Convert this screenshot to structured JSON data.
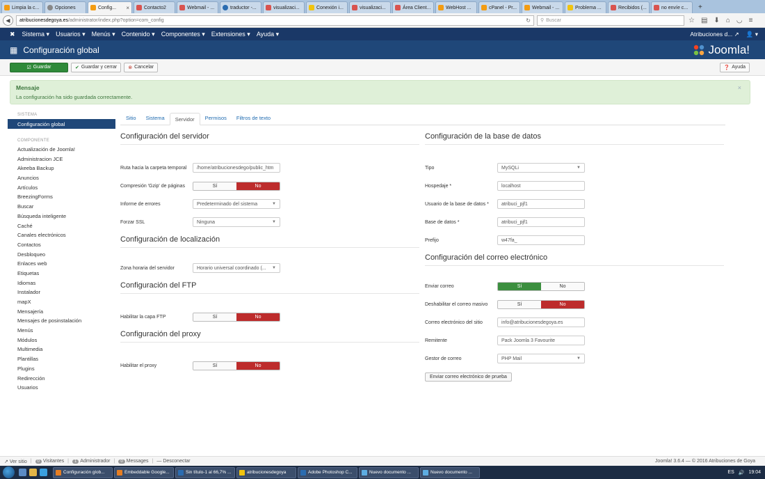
{
  "browser": {
    "tabs": [
      {
        "label": "Limpia la c...",
        "active": false
      },
      {
        "label": "Opciones",
        "active": false
      },
      {
        "label": "Config...",
        "active": true
      },
      {
        "label": "Contacto2",
        "active": false
      },
      {
        "label": "Webmail - ...",
        "active": false
      },
      {
        "label": "traductor -...",
        "active": false
      },
      {
        "label": "visualizaci...",
        "active": false
      },
      {
        "label": "Conexión i...",
        "active": false
      },
      {
        "label": "visualizaci...",
        "active": false
      },
      {
        "label": "Área Client...",
        "active": false
      },
      {
        "label": "WebHost ...",
        "active": false
      },
      {
        "label": "cPanel - Pr...",
        "active": false
      },
      {
        "label": "Webmail - ...",
        "active": false
      },
      {
        "label": "Problema ...",
        "active": false
      },
      {
        "label": "Recibidos (...",
        "active": false
      },
      {
        "label": "no envíe c...",
        "active": false
      }
    ],
    "new_tab": "+",
    "url_host": "atribucionesdegoya.es",
    "url_path": "/administrator/index.php?option=com_config",
    "search_placeholder": "Buscar"
  },
  "topmenu": {
    "items": [
      "Sistema ▾",
      "Usuarios ▾",
      "Menús ▾",
      "Contenido ▾",
      "Componentes ▾",
      "Extensiones ▾",
      "Ayuda ▾"
    ],
    "site_name": "Atribuciones d...",
    "user": "▾"
  },
  "header": {
    "title": "Configuración global",
    "logo_text": "Joomla!"
  },
  "toolbar": {
    "save": "Guardar",
    "save_close": "Guardar y cerrar",
    "cancel": "Cancelar",
    "help": "Ayuda"
  },
  "alert": {
    "title": "Mensaje",
    "message": "La configuración ha sido guardada correctamente.",
    "close": "×"
  },
  "sidebar": {
    "system_heading": "SISTEMA",
    "active_item": "Configuración global",
    "component_heading": "COMPONENTE",
    "items": [
      "Actualización de Joomla!",
      "Administracion JCE",
      "Akeeba Backup",
      "Anuncios",
      "Artículos",
      "BreezingForms",
      "Buscar",
      "Búsqueda inteligente",
      "Caché",
      "Canales electrónicos",
      "Contactos",
      "Desbloqueo",
      "Enlaces web",
      "Etiquetas",
      "Idiomas",
      "Instalador",
      "mapX",
      "Mensajería",
      "Mensajes de posinstalación",
      "Menús",
      "Módulos",
      "Multimedia",
      "Plantillas",
      "Plugins",
      "Redirección",
      "Usuarios"
    ]
  },
  "tabs": [
    "Sitio",
    "Sistema",
    "Servidor",
    "Permisos",
    "Filtros de texto"
  ],
  "active_tab": "Servidor",
  "server": {
    "title": "Configuración del servidor",
    "tmp_label": "Ruta hacia la carpeta temporal",
    "tmp_value": "/home/atribucionesdego/public_htm",
    "gzip_label": "Compresión 'Gzip' de páginas",
    "errors_label": "Informe de errores",
    "errors_value": "Predeterminado del sistema",
    "ssl_label": "Forzar SSL",
    "ssl_value": "Ninguna"
  },
  "locale": {
    "title": "Configuración de localización",
    "tz_label": "Zona horaria del servidor",
    "tz_value": "Horario universal coordinado (..."
  },
  "ftp": {
    "title": "Configuración del FTP",
    "enable_label": "Habilitar la capa FTP"
  },
  "proxy": {
    "title": "Configuración del proxy",
    "enable_label": "Habilitar el proxy"
  },
  "toggle": {
    "yes": "Sí",
    "no": "No"
  },
  "database": {
    "title": "Configuración de la base de datos",
    "type_label": "Tipo",
    "type_value": "MySQLi",
    "host_label": "Hospedaje *",
    "host_value": "localhost",
    "user_label": "Usuario de la base de datos *",
    "user_value": "atribuci_pjf1",
    "db_label": "Base de datos *",
    "db_value": "atribuci_pjf1",
    "prefix_label": "Prefijo",
    "prefix_value": "w47fa_"
  },
  "mail": {
    "title": "Configuración del correo electrónico",
    "send_label": "Enviar correo",
    "disable_mass_label": "Deshabilitar el correo masivo",
    "from_email_label": "Correo electrónico del sitio",
    "from_email_value": "info@atribucionesdegoya.es",
    "from_name_label": "Remitente",
    "from_name_value": "Pack Joomla 3 Favourite",
    "mailer_label": "Gestor de correo",
    "mailer_value": "PHP Mail",
    "test_button": "Enviar correo electrónico de prueba"
  },
  "statusbar": {
    "view_site": "Ver sitio",
    "visitors_count": "0",
    "visitors": "Visitantes",
    "admins_count": "1",
    "admins": "Administrador",
    "messages_count": "0",
    "messages": "Messages",
    "logout": "Desconectar",
    "version": "Joomla! 3.6.4 — © 2016 Atribuciones de Goya"
  },
  "taskbar": {
    "items": [
      "Configuración glob...",
      "Embeddable Google...",
      "Sin título-1 al 66,7% ...",
      "atribucionesdegoya",
      "Adobe Photoshop C...",
      "Nuevo documento ...",
      "Nuevo documento ..."
    ],
    "lang": "ES",
    "time": "19:04"
  },
  "colors": {
    "brand_dark": "#1a3867",
    "brand": "#1f4779",
    "save_green": "#2f8a3a",
    "toggle_red": "#bd2c2c",
    "toggle_green": "#3c8f3f",
    "success_bg": "#dff0d8"
  }
}
